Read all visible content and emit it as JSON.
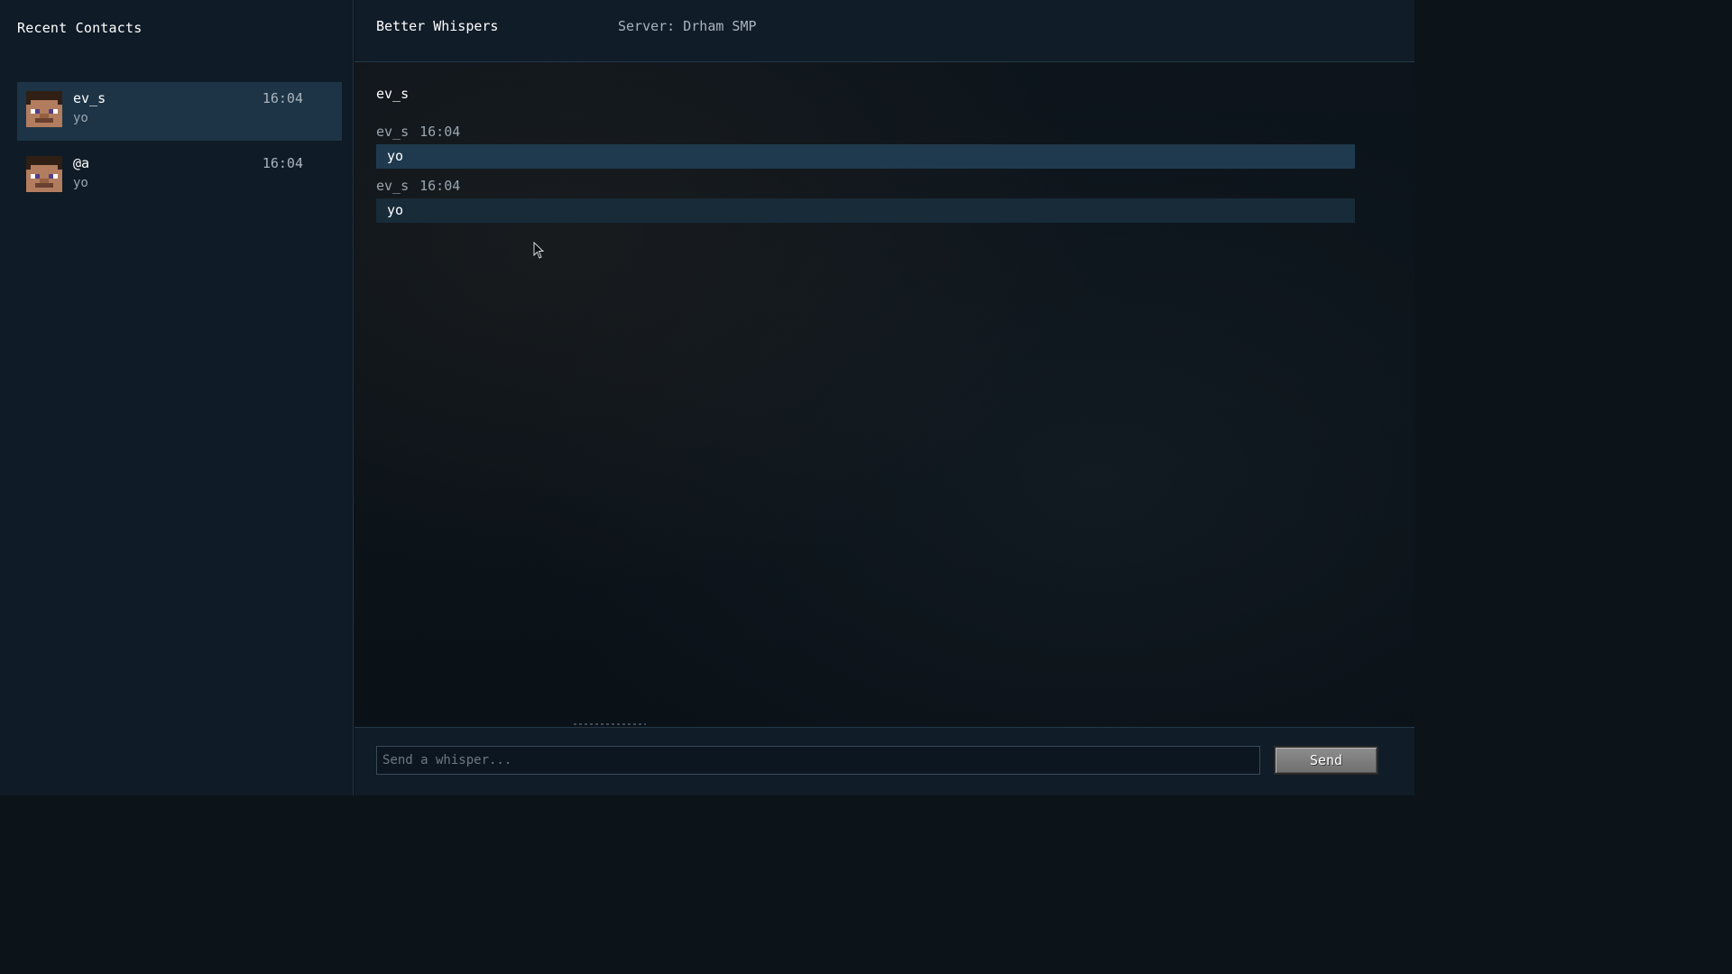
{
  "sidebar": {
    "title": "Recent Contacts",
    "contacts": [
      {
        "name": "ev_s",
        "preview": "yo",
        "time": "16:04",
        "selected": true
      },
      {
        "name": "@a",
        "preview": "yo",
        "time": "16:04",
        "selected": false
      }
    ]
  },
  "header": {
    "app_title": "Better Whispers",
    "server_label": "Server: Drham SMP"
  },
  "conversation": {
    "contact_name": "ev_s",
    "messages": [
      {
        "sender": "ev_s",
        "time": "16:04",
        "text": "yo"
      },
      {
        "sender": "ev_s",
        "time": "16:04",
        "text": "yo"
      }
    ]
  },
  "composer": {
    "placeholder": "Send a whisper...",
    "value": "",
    "send_label": "Send"
  },
  "colors": {
    "sidebar_bg": "#0f1b26",
    "selected_contact_bg": "#1d3446",
    "header_bg": "#101c27",
    "bubble_highlight": "#1f3a4e",
    "bubble_normal": "#182b39",
    "button_gray": "#7f7f7f"
  },
  "icons": {
    "avatar": "steve-face-icon",
    "cursor": "mouse-pointer-icon"
  }
}
